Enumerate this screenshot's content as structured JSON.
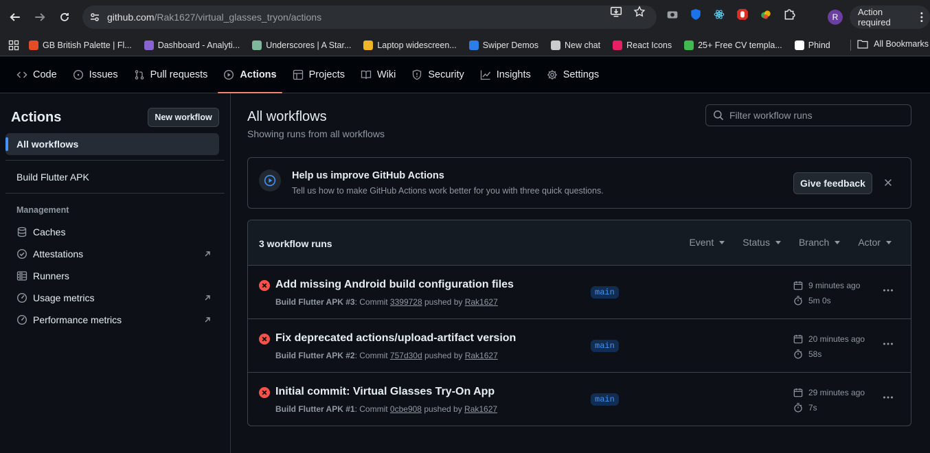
{
  "browser": {
    "url_host": "github.com",
    "url_path": "/Rak1627/virtual_glasses_tryon/actions",
    "profile_initial": "R",
    "action_required": "Action required"
  },
  "bookmarks": [
    {
      "label": "GB British Palette | Fl...",
      "color": "#e34c26"
    },
    {
      "label": "Dashboard - Analyti...",
      "color": "#8a63d2"
    },
    {
      "label": "Underscores | A Star...",
      "color": "#7fb89a"
    },
    {
      "label": "Laptop widescreen...",
      "color": "#f0b429"
    },
    {
      "label": "Swiper Demos",
      "color": "#2b7de9"
    },
    {
      "label": "New chat",
      "color": "#cccccc"
    },
    {
      "label": "React Icons",
      "color": "#e91e63"
    },
    {
      "label": "25+ Free CV templa...",
      "color": "#3fb950"
    },
    {
      "label": "Phind",
      "color": "#ffffff"
    }
  ],
  "all_bookmarks": "All Bookmarks",
  "repo_tabs": [
    {
      "label": "Code",
      "icon": "code-icon"
    },
    {
      "label": "Issues",
      "icon": "issue-icon"
    },
    {
      "label": "Pull requests",
      "icon": "pull-request-icon"
    },
    {
      "label": "Actions",
      "icon": "play-icon"
    },
    {
      "label": "Projects",
      "icon": "table-icon"
    },
    {
      "label": "Wiki",
      "icon": "book-icon"
    },
    {
      "label": "Security",
      "icon": "shield-icon"
    },
    {
      "label": "Insights",
      "icon": "graph-icon"
    },
    {
      "label": "Settings",
      "icon": "gear-icon"
    }
  ],
  "sidebar": {
    "title": "Actions",
    "new_workflow": "New workflow",
    "all_workflows": "All workflows",
    "workflow": "Build Flutter APK",
    "management_heading": "Management",
    "management": [
      {
        "label": "Caches",
        "icon": "database-icon"
      },
      {
        "label": "Attestations",
        "icon": "verified-icon"
      },
      {
        "label": "Runners",
        "icon": "server-icon"
      },
      {
        "label": "Usage metrics",
        "icon": "meter-icon"
      },
      {
        "label": "Performance metrics",
        "icon": "meter-icon"
      }
    ]
  },
  "main": {
    "title": "All workflows",
    "subtitle": "Showing runs from all workflows",
    "filter_placeholder": "Filter workflow runs",
    "banner": {
      "title": "Help us improve GitHub Actions",
      "description": "Tell us how to make GitHub Actions work better for you with three quick questions.",
      "button": "Give feedback"
    },
    "runs_count": "3 workflow runs",
    "filters": [
      "Event",
      "Status",
      "Branch",
      "Actor"
    ],
    "runs": [
      {
        "title": "Add missing Android build configuration files",
        "workflow": "Build Flutter APK #3",
        "commit_prefix": ": Commit",
        "commit": "3399728",
        "pushed_by": "pushed by",
        "author": "Rak1627",
        "branch": "main",
        "time": "9 minutes ago",
        "duration": "5m 0s"
      },
      {
        "title": "Fix deprecated actions/upload-artifact version",
        "workflow": "Build Flutter APK #2",
        "commit_prefix": ": Commit",
        "commit": "757d30d",
        "pushed_by": "pushed by",
        "author": "Rak1627",
        "branch": "main",
        "time": "20 minutes ago",
        "duration": "58s"
      },
      {
        "title": "Initial commit: Virtual Glasses Try-On App",
        "workflow": "Build Flutter APK #1",
        "commit_prefix": ": Commit",
        "commit": "0cbe908",
        "pushed_by": "pushed by",
        "author": "Rak1627",
        "branch": "main",
        "time": "29 minutes ago",
        "duration": "7s"
      }
    ]
  }
}
